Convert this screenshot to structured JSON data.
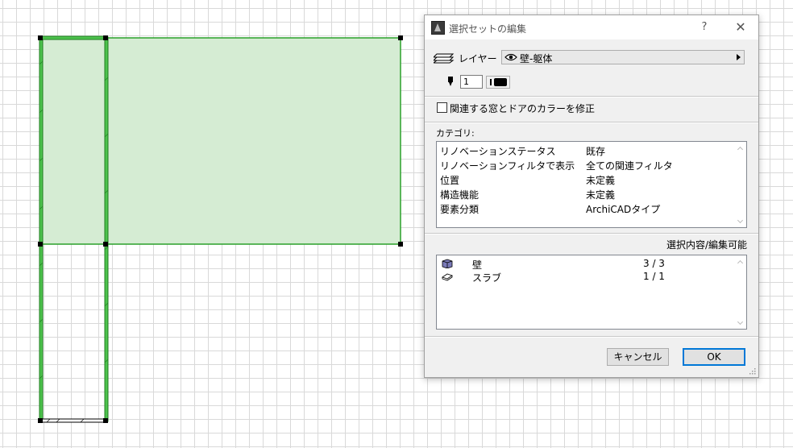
{
  "dialog": {
    "title": "選択セットの編集",
    "help_label": "?",
    "close_label": "✕",
    "layer": {
      "label": "レイヤー",
      "value": "壁-躯体"
    },
    "pen": {
      "value": "1"
    },
    "checkbox_label": "関連する窓とドアのカラーを修正",
    "category_label": "カテゴリ:",
    "categories": [
      {
        "name": "リノベーションステータス",
        "value": "既存"
      },
      {
        "name": "リノベーションフィルタで表示",
        "value": "全ての関連フィルタ"
      },
      {
        "name": "位置",
        "value": "未定義"
      },
      {
        "name": "構造機能",
        "value": "未定義"
      },
      {
        "name": "要素分類",
        "value": "ArchiCADタイプ"
      }
    ],
    "selection_label": "選択内容/編集可能",
    "selection": [
      {
        "icon": "wall-icon",
        "name": "壁",
        "count": "3 / 3"
      },
      {
        "icon": "slab-icon",
        "name": "スラブ",
        "count": "1 / 1"
      }
    ],
    "cancel_label": "キャンセル",
    "ok_label": "OK"
  },
  "colors": {
    "selection_fill": "#d5ecd3",
    "selection_stroke": "#2aa12a",
    "ok_border": "#0078d7"
  }
}
